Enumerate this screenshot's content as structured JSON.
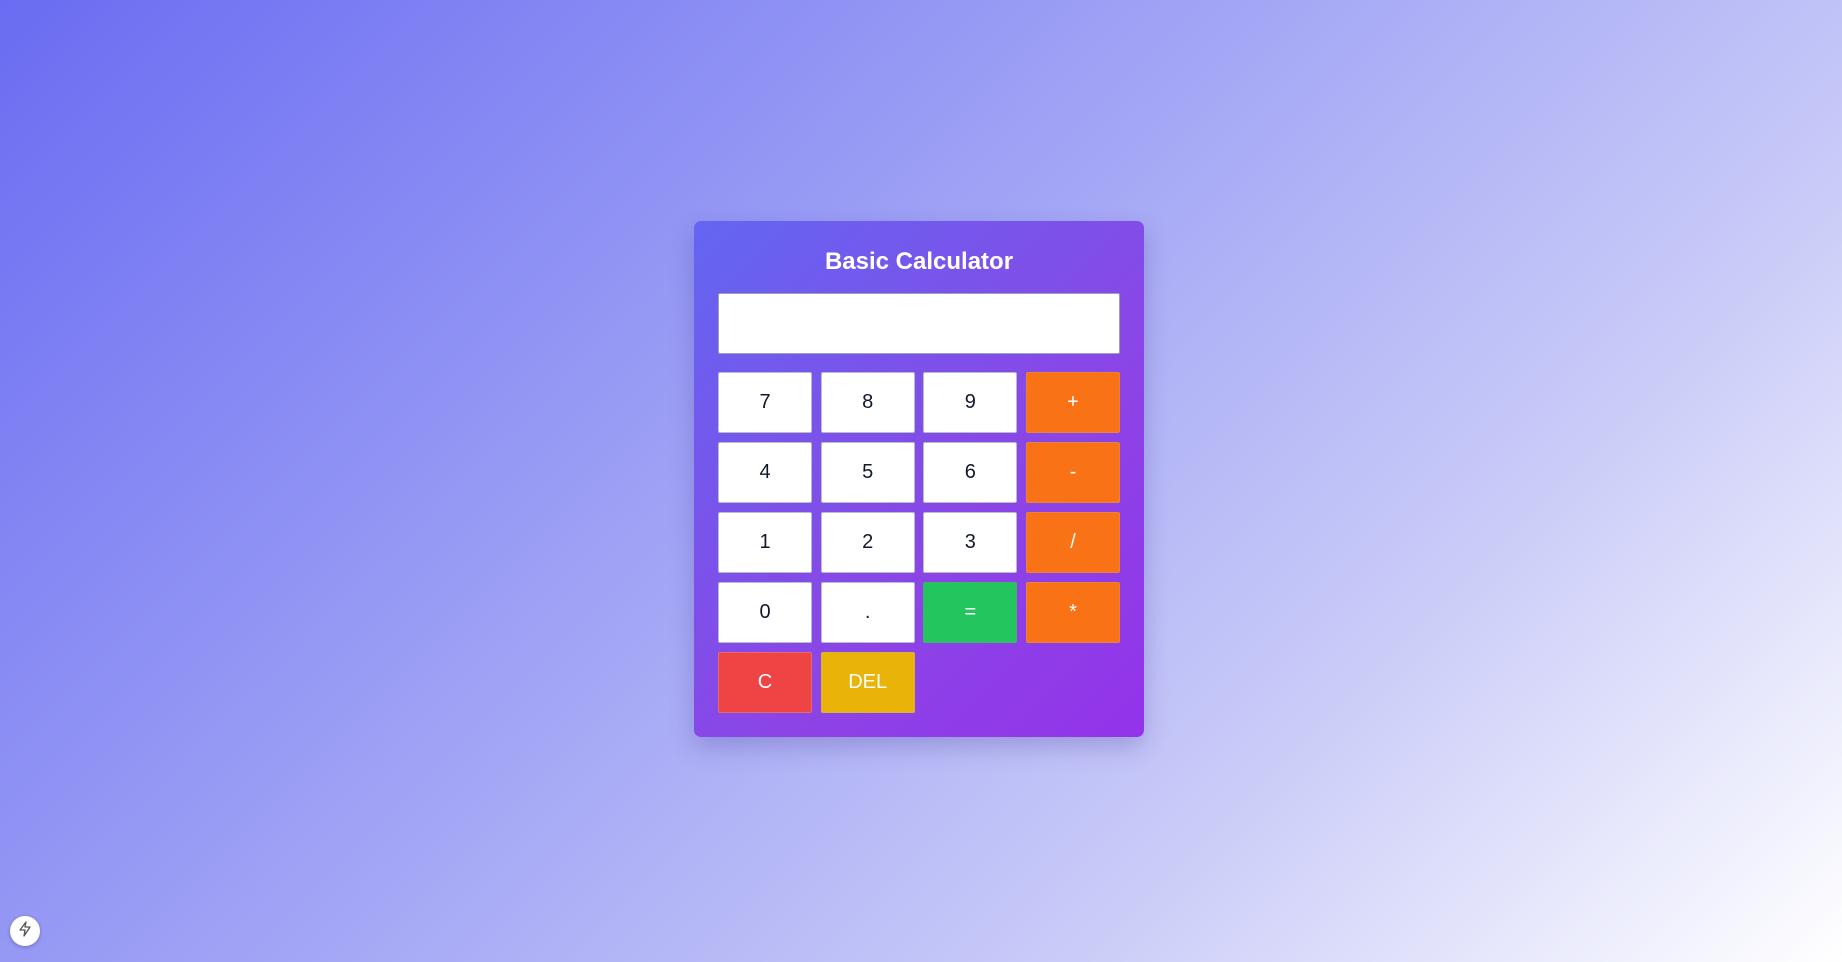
{
  "app": {
    "title": "Basic Calculator"
  },
  "display": {
    "value": ""
  },
  "keys": {
    "k7": "7",
    "k8": "8",
    "k9": "9",
    "plus": "+",
    "k4": "4",
    "k5": "5",
    "k6": "6",
    "minus": "-",
    "k1": "1",
    "k2": "2",
    "k3": "3",
    "divide": "/",
    "k0": "0",
    "dot": ".",
    "equals": "=",
    "multiply": "*",
    "clear": "C",
    "del": "DEL"
  },
  "colors": {
    "operator": "#f97316",
    "equals": "#22c55e",
    "clear": "#ef4444",
    "delete": "#eab308",
    "panel_start": "#6366f1",
    "panel_end": "#9333ea"
  },
  "icons": {
    "corner_badge": "bolt-icon"
  }
}
